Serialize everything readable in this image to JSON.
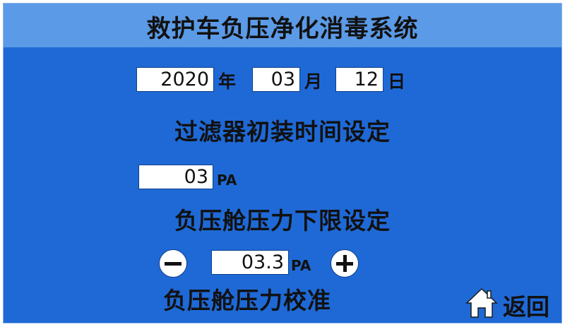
{
  "header": {
    "title": "救护车负压净化消毒系统"
  },
  "filter_date": {
    "year": "2020",
    "year_unit": "年",
    "month": "03",
    "month_unit": "月",
    "day": "12",
    "day_unit": "日",
    "label": "过滤器初装时间设定"
  },
  "lower_limit": {
    "value": "03",
    "unit": "PA",
    "label": "负压舱压力下限设定"
  },
  "calibration": {
    "value": "03.3",
    "unit": "PA",
    "label": "负压舱压力校准"
  },
  "nav": {
    "return_label": "返回"
  },
  "icons": {
    "decrement": "minus-icon",
    "increment": "plus-icon",
    "home": "home-icon"
  },
  "colors": {
    "panel": "#1f69d6",
    "titlebar": "#5b9ae6",
    "field_bg": "#ffffff",
    "text": "#111111"
  }
}
